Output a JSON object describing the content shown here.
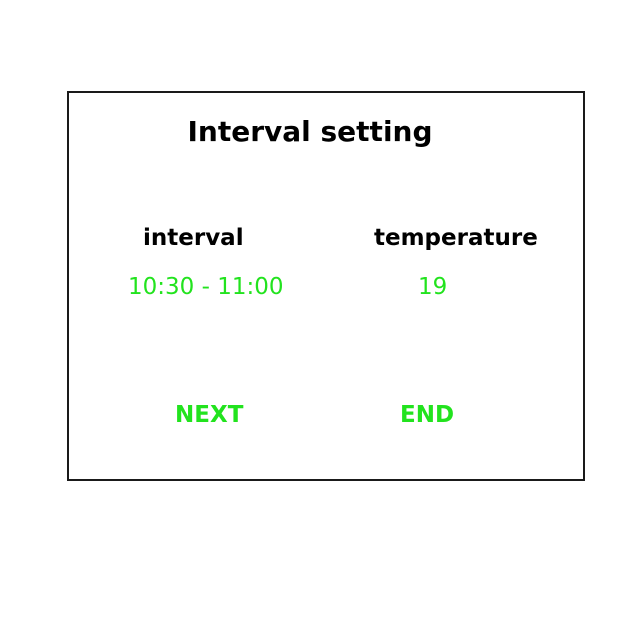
{
  "dialog": {
    "title": "Interval setting",
    "interval_label": "interval",
    "interval_value": "10:30 - 11:00",
    "temperature_label": "temperature",
    "temperature_value": "19",
    "next_label": "NEXT",
    "end_label": "END"
  },
  "colors": {
    "value_text": "#22e31e",
    "border": "#1a1a1a",
    "label_text": "#000000"
  }
}
